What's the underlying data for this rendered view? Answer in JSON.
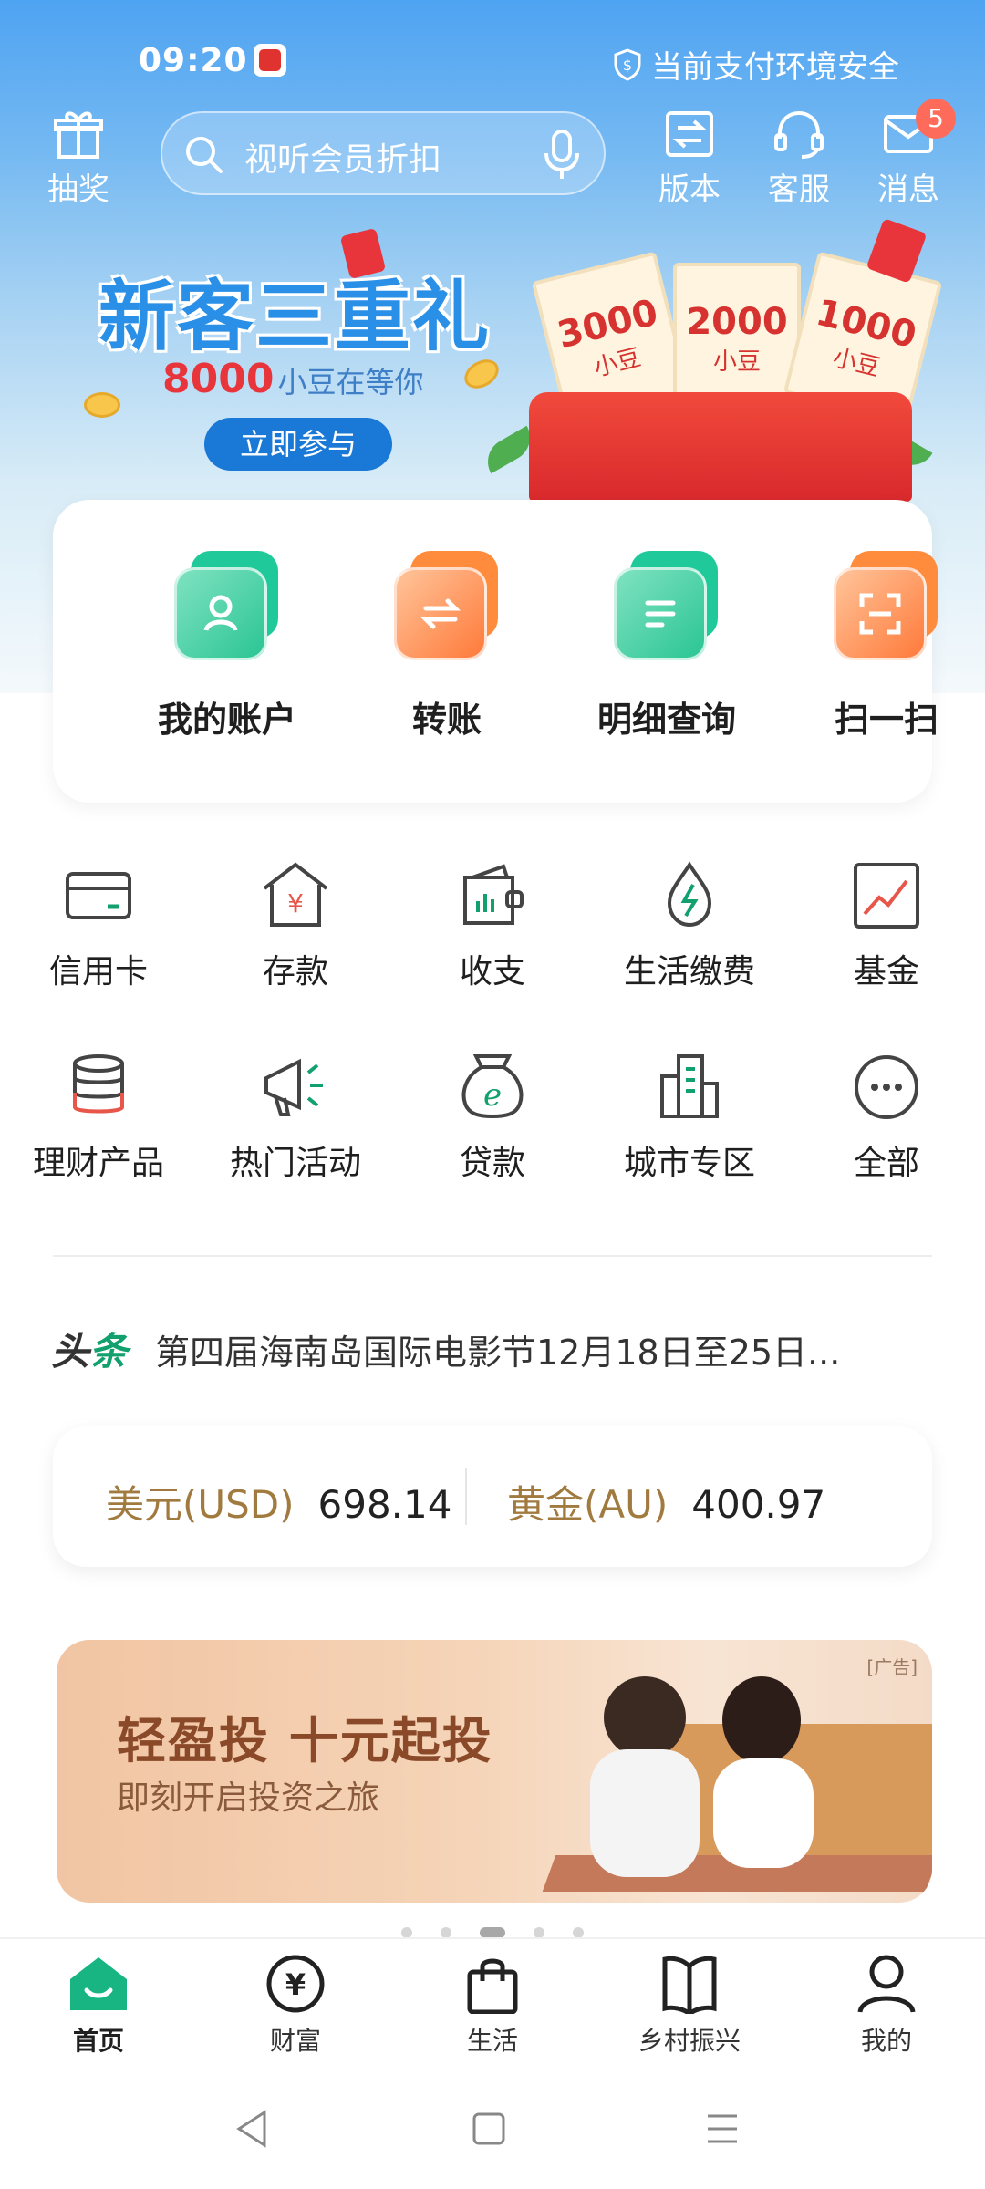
{
  "status_bar": {
    "time": "09:20",
    "security_text": "当前支付环境安全",
    "shield_icon": "shield-icon"
  },
  "header": {
    "lottery_label": "抽奖",
    "search_placeholder": "视听会员折扣",
    "version_label": "版本",
    "service_label": "客服",
    "message_label": "消息",
    "message_badge": "5"
  },
  "banner": {
    "title": "新客三重礼",
    "amount": "8000",
    "subtitle_suffix": "小豆在等你",
    "button_label": "立即参与",
    "tickets": [
      {
        "amount": "3000",
        "unit": "小豆"
      },
      {
        "amount": "2000",
        "unit": "小豆"
      },
      {
        "amount": "1000",
        "unit": "小豆"
      }
    ]
  },
  "quick_actions": [
    {
      "label": "我的账户",
      "icon": "account-icon",
      "color": "green"
    },
    {
      "label": "转账",
      "icon": "transfer-icon",
      "color": "orange"
    },
    {
      "label": "明细查询",
      "icon": "statement-icon",
      "color": "green"
    },
    {
      "label": "扫一扫",
      "icon": "scan-icon",
      "color": "orange"
    }
  ],
  "services": [
    {
      "label": "信用卡",
      "icon": "credit-card-icon"
    },
    {
      "label": "存款",
      "icon": "deposit-icon"
    },
    {
      "label": "收支",
      "icon": "wallet-chart-icon"
    },
    {
      "label": "生活缴费",
      "icon": "utility-bill-icon"
    },
    {
      "label": "基金",
      "icon": "fund-chart-icon"
    },
    {
      "label": "理财产品",
      "icon": "wealth-coins-icon"
    },
    {
      "label": "热门活动",
      "icon": "megaphone-icon"
    },
    {
      "label": "贷款",
      "icon": "loan-bag-icon"
    },
    {
      "label": "城市专区",
      "icon": "city-buildings-icon"
    },
    {
      "label": "全部",
      "icon": "more-icon"
    }
  ],
  "headline": {
    "tag_a": "头",
    "tag_b": "条",
    "text": "第四届海南岛国际电影节12月18日至25日..."
  },
  "rates": {
    "usd_label": "美元(USD)",
    "usd_value": "698.14",
    "gold_label": "黄金(AU)",
    "gold_value": "400.97"
  },
  "ad": {
    "tag": "[广告]",
    "title": "轻盈投  十元起投",
    "subtitle": "即刻开启投资之旅"
  },
  "carousel": {
    "count": 5,
    "active_index": 2
  },
  "tabs": [
    {
      "label": "首页",
      "icon": "home-icon",
      "active": true
    },
    {
      "label": "财富",
      "icon": "yuan-circle-icon",
      "active": false
    },
    {
      "label": "生活",
      "icon": "shopping-bag-icon",
      "active": false
    },
    {
      "label": "乡村振兴",
      "icon": "open-book-icon",
      "active": false
    },
    {
      "label": "我的",
      "icon": "user-icon",
      "active": false
    }
  ],
  "colors": {
    "brand_green": "#12a06e",
    "sky_blue": "#4ea3f2",
    "accent_orange": "#ff7a3a",
    "badge_red": "#ff6b5b",
    "gold_text": "#a17a3f"
  }
}
